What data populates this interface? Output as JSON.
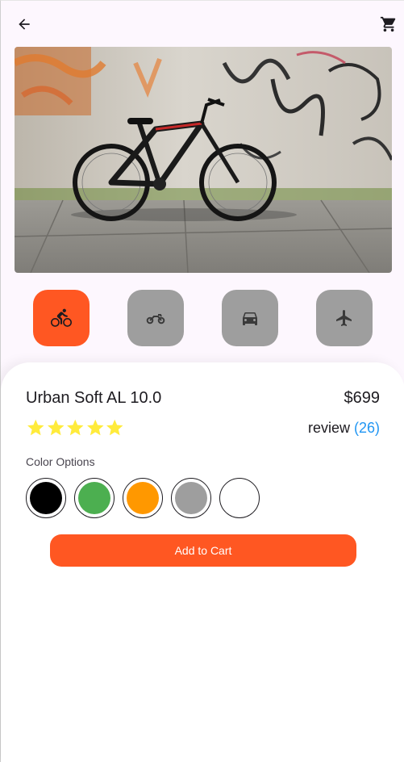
{
  "appbar": {
    "back_icon": "arrow-back-icon",
    "cart_icon": "shopping-cart-icon"
  },
  "hero": {
    "image": "bicycle-against-graffiti-wall"
  },
  "categories": [
    {
      "icon": "bicycle-icon",
      "active": true
    },
    {
      "icon": "motorcycle-icon",
      "active": false
    },
    {
      "icon": "car-icon",
      "active": false
    },
    {
      "icon": "airplane-icon",
      "active": false
    }
  ],
  "product": {
    "name": "Urban Soft AL 10.0",
    "price": "$699",
    "rating": 5,
    "review_label": "review",
    "review_count": "(26)"
  },
  "colors": {
    "label": "Color Options",
    "options": [
      "#000000",
      "#4caf50",
      "#ff9800",
      "#9e9e9e",
      "#ffffff"
    ]
  },
  "actions": {
    "add_to_cart": "Add to Cart"
  },
  "theme": {
    "accent": "#ff5722",
    "inactive": "#9e9e9e",
    "star": "#ffeb3b",
    "link": "#2196f3"
  }
}
